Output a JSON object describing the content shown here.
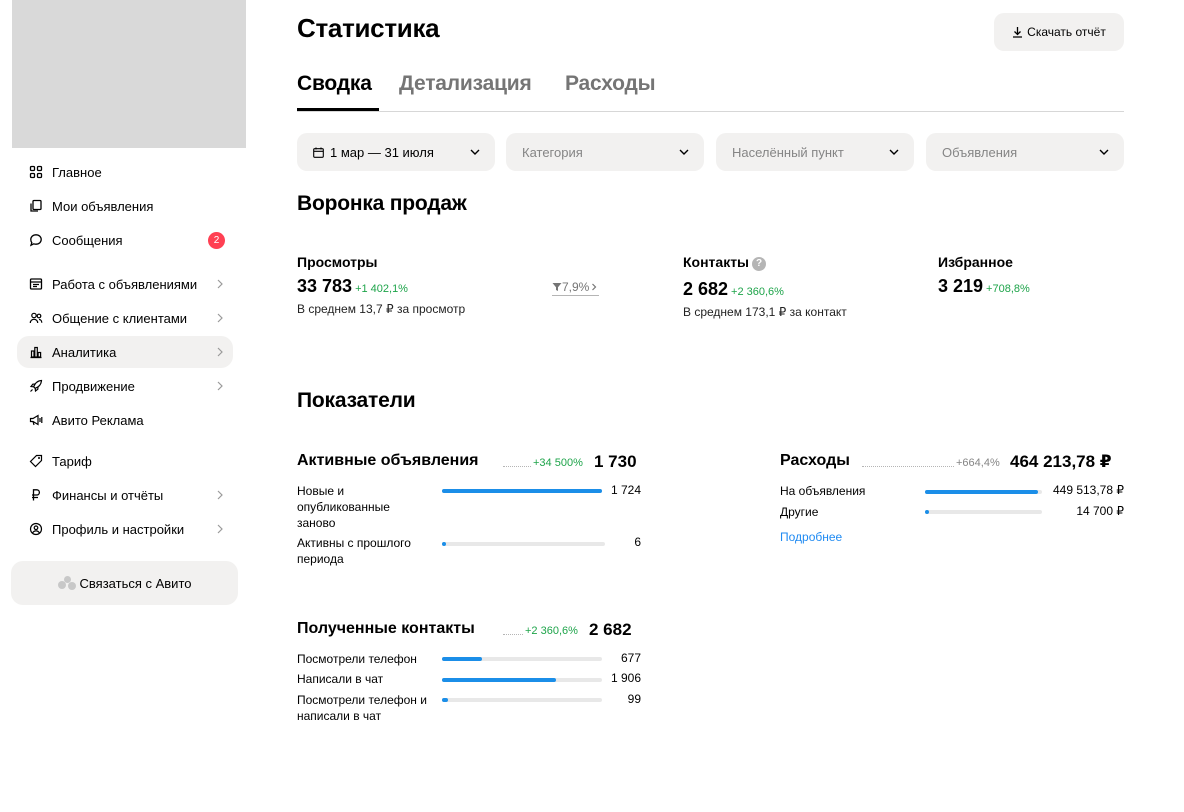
{
  "sidebar": {
    "items": [
      {
        "label": "Главное",
        "icon": "grid-icon"
      },
      {
        "label": "Мои объявления",
        "icon": "copy-icon"
      },
      {
        "label": "Сообщения",
        "icon": "chat-bubble-icon",
        "badge": "2"
      },
      {
        "label": "Работа с объявлениями",
        "icon": "list-card-icon"
      },
      {
        "label": "Общение с клиентами",
        "icon": "people-icon"
      },
      {
        "label": "Аналитика",
        "icon": "bar-chart-icon"
      },
      {
        "label": "Продвижение",
        "icon": "rocket-icon"
      },
      {
        "label": "Авито Реклама",
        "icon": "megaphone-icon"
      },
      {
        "label": "Тариф",
        "icon": "tag-icon"
      },
      {
        "label": "Финансы и отчёты",
        "icon": "ruble-icon"
      },
      {
        "label": "Профиль и настройки",
        "icon": "profile-icon"
      }
    ],
    "contact_button": "Связаться с Авито"
  },
  "header": {
    "title": "Статистика",
    "download_label": "Скачать отчёт"
  },
  "tabs": [
    {
      "label": "Сводка"
    },
    {
      "label": "Детализация"
    },
    {
      "label": "Расходы"
    }
  ],
  "filters": {
    "date": "1 мар — 31 июля",
    "category": "Категория",
    "city": "Населённый пункт",
    "ads": "Объявления"
  },
  "funnel": {
    "title": "Воронка продаж",
    "views": {
      "label": "Просмотры",
      "value": "33 783",
      "delta": "+1 402,1%",
      "sub": "В среднем 13,7 ₽ за просмотр"
    },
    "conversion": "7,9%",
    "contacts": {
      "label": "Контакты",
      "value": "2 682",
      "delta": "+2 360,6%",
      "sub": "В среднем 173,1 ₽ за контакт",
      "help": "?"
    },
    "favorites": {
      "label": "Избранное",
      "value": "3 219",
      "delta": "+708,8%"
    }
  },
  "indicators": {
    "title": "Показатели",
    "active_ads": {
      "title": "Активные объявления",
      "delta": "+34 500%",
      "total": "1 730",
      "rows": [
        {
          "label": "Новые и опубликованные заново",
          "value": "1 724",
          "fraction": 0.997
        },
        {
          "label": "Активны с прошлого периода",
          "value": "6",
          "fraction": 0.02
        }
      ]
    },
    "expenses": {
      "title": "Расходы",
      "delta": "+664,4%",
      "total": "464 213,78 ₽",
      "rows": [
        {
          "label": "На объявления",
          "value": "449 513,78 ₽",
          "fraction": 0.97
        },
        {
          "label": "Другие",
          "value": "14 700 ₽",
          "fraction": 0.03
        }
      ],
      "more": "Подробнее"
    },
    "contacts": {
      "title": "Полученные контакты",
      "delta": "+2 360,6%",
      "total": "2 682",
      "rows": [
        {
          "label": "Посмотрели телефон",
          "value": "677",
          "fraction": 0.25
        },
        {
          "label": "Написали в чат",
          "value": "1 906",
          "fraction": 0.71
        },
        {
          "label": "Посмотрели телефон и написали в чат",
          "value": "99",
          "fraction": 0.04
        }
      ]
    }
  },
  "colors": {
    "accent": "#1b8ee8",
    "positive": "#1ea44a",
    "badge": "#ff4053",
    "surface": "#f2f1f0",
    "link": "#1f8af2"
  }
}
